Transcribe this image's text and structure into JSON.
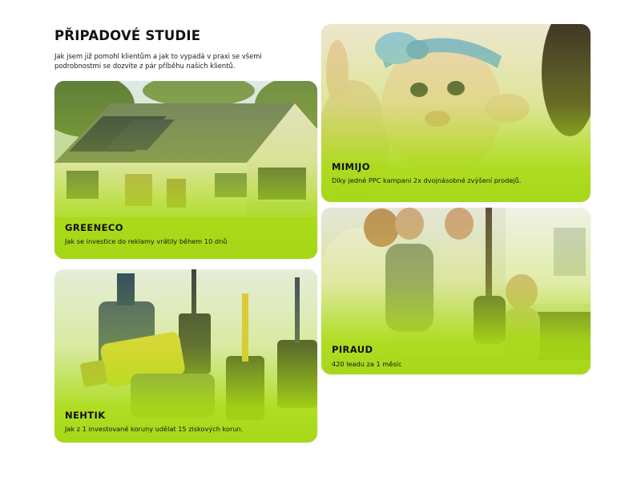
{
  "page": {
    "title": "PŘIPADOVÉ STUDIE",
    "intro": "Jak jsem již pomohl klientům a jak to vypadá v praxi se všemi podrobnostmi se dozvíte z pár příběhu našich klientů."
  },
  "colors": {
    "accent": "#a8d81a",
    "text": "#121212",
    "background": "#ffffff"
  },
  "cases": {
    "greeneco": {
      "name": "GREENECO",
      "description": "Jak se investice do reklamy vrátily během 10 dnů",
      "image": "house-with-solar-panels"
    },
    "mimijo": {
      "name": "MIMIJO",
      "description": "Díky jedné PPC kampani 2x dvojnásobné zvýšení prodejů.",
      "image": "baby-with-headband"
    },
    "nehtik": {
      "name": "NEHTIK",
      "description": "Jak z 1 investované koruny udělat 15 ziskových korun.",
      "image": "nail-polish-bottles"
    },
    "piraud": {
      "name": "PIRAUD",
      "description": "420 leadu za 1 měsíc",
      "image": "team-in-office"
    }
  }
}
